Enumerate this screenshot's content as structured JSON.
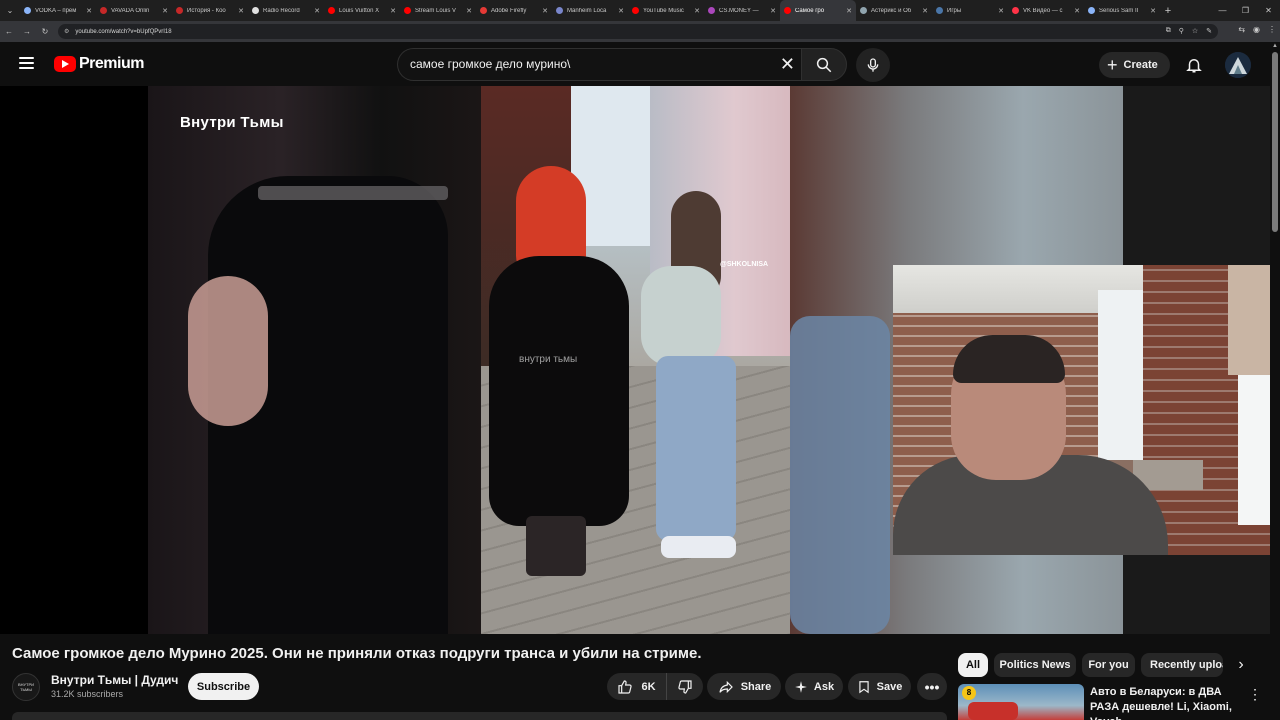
{
  "browser": {
    "tabs": [
      {
        "title": "VODKA – прем",
        "color": "#8ab4f8"
      },
      {
        "title": "VAVADA Onlin",
        "color": "#c62828"
      },
      {
        "title": "История - Коо",
        "color": "#c62828"
      },
      {
        "title": "Radio Record",
        "color": "#e0e0e0"
      },
      {
        "title": "Louis Vuitton X",
        "color": "#ff0000"
      },
      {
        "title": "Stream Louis V",
        "color": "#ff0000"
      },
      {
        "title": "Adobe Firefly",
        "color": "#e53935"
      },
      {
        "title": "Manheim Loca",
        "color": "#7986cb"
      },
      {
        "title": "YouTube Music",
        "color": "#ff0000"
      },
      {
        "title": "CS.MONEY —",
        "color": "#ab47bc"
      },
      {
        "title": "Самое гро",
        "color": "#ff0000",
        "active": true
      },
      {
        "title": "Астерикс и Об",
        "color": "#90a4ae"
      },
      {
        "title": "Игры",
        "color": "#4a76a8"
      },
      {
        "title": "VK Видео — с",
        "color": "#ff3347"
      },
      {
        "title": "Serious Sam II",
        "color": "#8ab4f8"
      }
    ],
    "url": "youtube.com/watch?v=bUpfQPvrI18"
  },
  "header": {
    "logo_text": "Premium",
    "search_value": "самое громкое дело мурино\\",
    "create_label": "Create"
  },
  "player": {
    "watermark_channel": "Внутри Тьмы",
    "watermark_mid": "внутри тьмы",
    "watermark_tag": "@SHKOLNISA"
  },
  "video": {
    "title": "Самое громкое дело Мурино 2025. Они не приняли отказ подруги транса и убили на стриме.",
    "channel_name": "Внутри Тьмы | Дудич",
    "channel_avatar_text": "ВНУТРИ ТЬМЫ",
    "subscribers": "31.2K subscribers",
    "subscribe_label": "Subscribe",
    "likes": "6K",
    "share_label": "Share",
    "ask_label": "Ask",
    "save_label": "Save"
  },
  "chips": [
    "All",
    "Politics News",
    "For you",
    "Recently uploa"
  ],
  "recommended": [
    {
      "title": "Авто в Беларуси: в ДВА РАЗА дешевле! Li, Xiaomi, Voyah, ...",
      "badge": "8"
    }
  ]
}
